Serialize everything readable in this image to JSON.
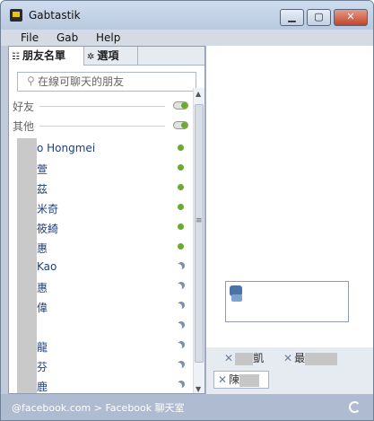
{
  "window": {
    "title": "Gabtastik",
    "min_label": "▁",
    "max_label": "▢",
    "close_label": "✕"
  },
  "menu": [
    "File",
    "Gab",
    "Help"
  ],
  "tabs": {
    "friends": "朋友名單",
    "options": "選項"
  },
  "search": {
    "placeholder": "在線可聊天的朋友"
  },
  "groups": {
    "friends": "好友",
    "others": "其他"
  },
  "friends": [
    {
      "name": "o Hongmei",
      "status": "online"
    },
    {
      "name": "萱",
      "status": "online"
    },
    {
      "name": "茲",
      "status": "online"
    },
    {
      "name": "米奇",
      "status": "online"
    },
    {
      "name": "筱綺",
      "status": "online"
    },
    {
      "name": "惠",
      "status": "online"
    },
    {
      "name": "Kao",
      "status": "idle"
    },
    {
      "name": "惠",
      "status": "idle"
    },
    {
      "name": "偉",
      "status": "idle"
    },
    {
      "name": "",
      "status": "idle"
    },
    {
      "name": "龍",
      "status": "idle"
    },
    {
      "name": "芬",
      "status": "idle"
    },
    {
      "name": "鹿",
      "status": "idle"
    }
  ],
  "chat_tabs": [
    {
      "x": "✕",
      "name": "凱"
    },
    {
      "x": "✕",
      "name": "最"
    },
    {
      "x": "✕",
      "name": "陳"
    }
  ],
  "statusbar": {
    "text": "@facebook.com > Facebook 聊天室"
  },
  "colors": {
    "online": "#6aaa2d",
    "idle": "#7a8fb0",
    "link": "#1f3f7a"
  }
}
